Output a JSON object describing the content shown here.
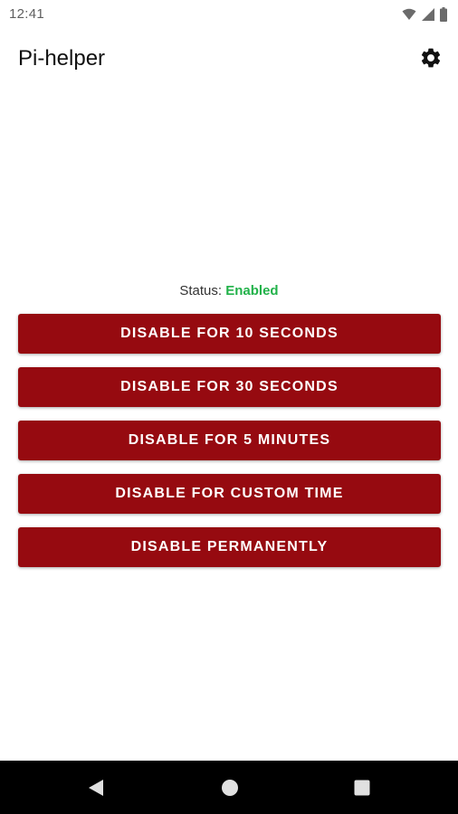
{
  "status_bar": {
    "time": "12:41",
    "icons": [
      "wifi-icon",
      "cellular-signal-icon",
      "battery-icon"
    ]
  },
  "app_bar": {
    "title": "Pi-helper",
    "settings_icon": "gear-icon"
  },
  "status": {
    "label": "Status:",
    "value": "Enabled",
    "value_color": "#22b24a"
  },
  "actions": [
    {
      "label": "DISABLE FOR 10 SECONDS"
    },
    {
      "label": "DISABLE FOR 30 SECONDS"
    },
    {
      "label": "DISABLE FOR 5 MINUTES"
    },
    {
      "label": "DISABLE FOR CUSTOM TIME"
    },
    {
      "label": "DISABLE PERMANENTLY"
    }
  ],
  "colors": {
    "button_background": "#960a10",
    "button_text": "#ffffff",
    "nav_background": "#000000"
  },
  "nav_bar": {
    "icons": [
      "back-icon",
      "home-icon",
      "recents-icon"
    ]
  }
}
